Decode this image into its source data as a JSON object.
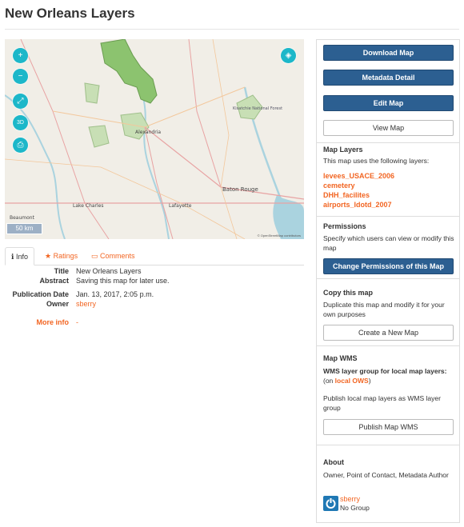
{
  "page": {
    "title": "New Orleans Layers"
  },
  "map": {
    "scale_label": "50 km",
    "attribution": "© OpenStreetMap contributors",
    "places": [
      "Alexandria",
      "Baton Rouge",
      "Lafayette",
      "Lake Charles",
      "Beaumont",
      "Kisatchie National Forest"
    ]
  },
  "tabs": [
    {
      "label": "Info",
      "icon": "info-icon"
    },
    {
      "label": "Ratings",
      "icon": "star-icon"
    },
    {
      "label": "Comments",
      "icon": "comment-icon"
    }
  ],
  "info": {
    "title_label": "Title",
    "title_value": "New Orleans Layers",
    "abstract_label": "Abstract",
    "abstract_value": "Saving this map for later use.",
    "pubdate_label": "Publication Date",
    "pubdate_value": "Jan. 13, 2017, 2:05 p.m.",
    "owner_label": "Owner",
    "owner_value": "sberry",
    "more_label": "More info",
    "more_value": "-"
  },
  "sidebar": {
    "download": "Download Map",
    "metadata": "Metadata Detail",
    "edit": "Edit Map",
    "view": "View Map",
    "layers_title": "Map Layers",
    "layers_text": "This map uses the following layers:",
    "layers": [
      "levees_USACE_2006",
      "cemetery",
      "DHH_facilites",
      "airports_ldotd_2007"
    ],
    "perm_title": "Permissions",
    "perm_text": "Specify which users can view or modify this map",
    "perm_button": "Change Permissions of this Map",
    "copy_title": "Copy this map",
    "copy_text": "Duplicate this map and modify it for your own purposes",
    "copy_button": "Create a New Map",
    "wms_title": "Map WMS",
    "wms_bold": "WMS layer group for local map layers:",
    "wms_pre": "(on ",
    "wms_link": "local OWS",
    "wms_post": ")",
    "wms_text": "Publish local map layers as WMS layer group",
    "wms_button": "Publish Map WMS",
    "about_title": "About",
    "about_text": "Owner, Point of Contact, Metadata Author",
    "about_user": "sberry",
    "about_group": "No Group"
  },
  "colors": {
    "accent": "#f26522",
    "primary": "#2c5f91",
    "map_control": "#1cb7c9",
    "forest": "#8cc36f"
  }
}
